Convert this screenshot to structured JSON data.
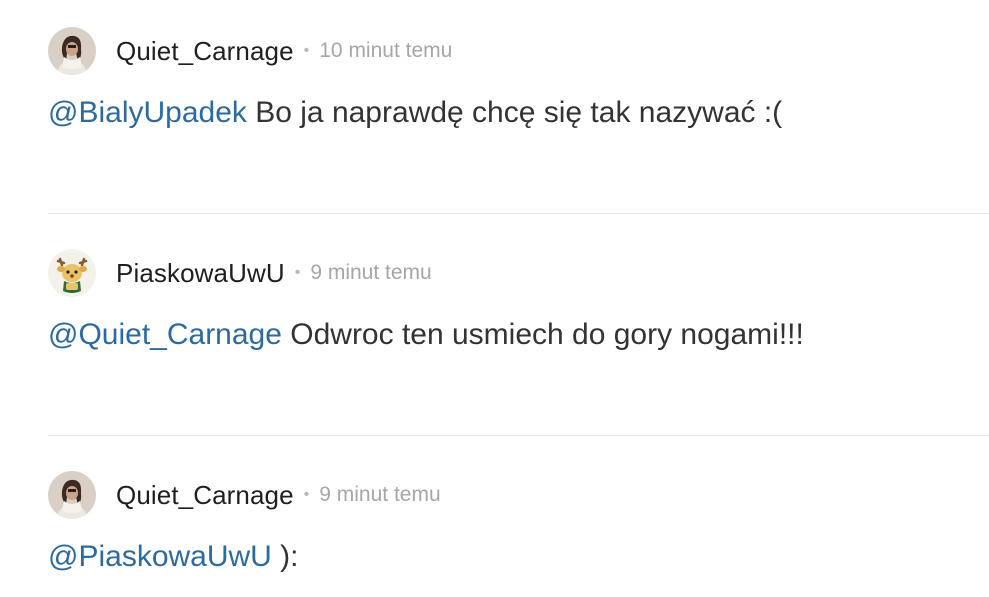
{
  "comments": [
    {
      "author": "Quiet_Carnage",
      "separator": "•",
      "time": "10 minut temu",
      "mention": "@BialyUpadek",
      "text": " Bo ja naprawdę chcę się tak nazywać :(",
      "avatar_icon": "dark-haired-figure-avatar"
    },
    {
      "author": "PiaskowaUwU",
      "separator": "•",
      "time": "9 minut temu",
      "mention": "@Quiet_Carnage",
      "text": " Odwroc ten usmiech do gory nogami!!!",
      "avatar_icon": "reindeer-plush-avatar"
    },
    {
      "author": "Quiet_Carnage",
      "separator": "•",
      "time": "9 minut temu",
      "mention": "@PiaskowaUwU",
      "text": " ):",
      "avatar_icon": "dark-haired-figure-avatar"
    }
  ],
  "colors": {
    "mention": "#2c6aa0",
    "text": "#333333",
    "username": "#1f1f1f",
    "timestamp": "#a6a6a6",
    "divider": "#e8e8e8"
  }
}
